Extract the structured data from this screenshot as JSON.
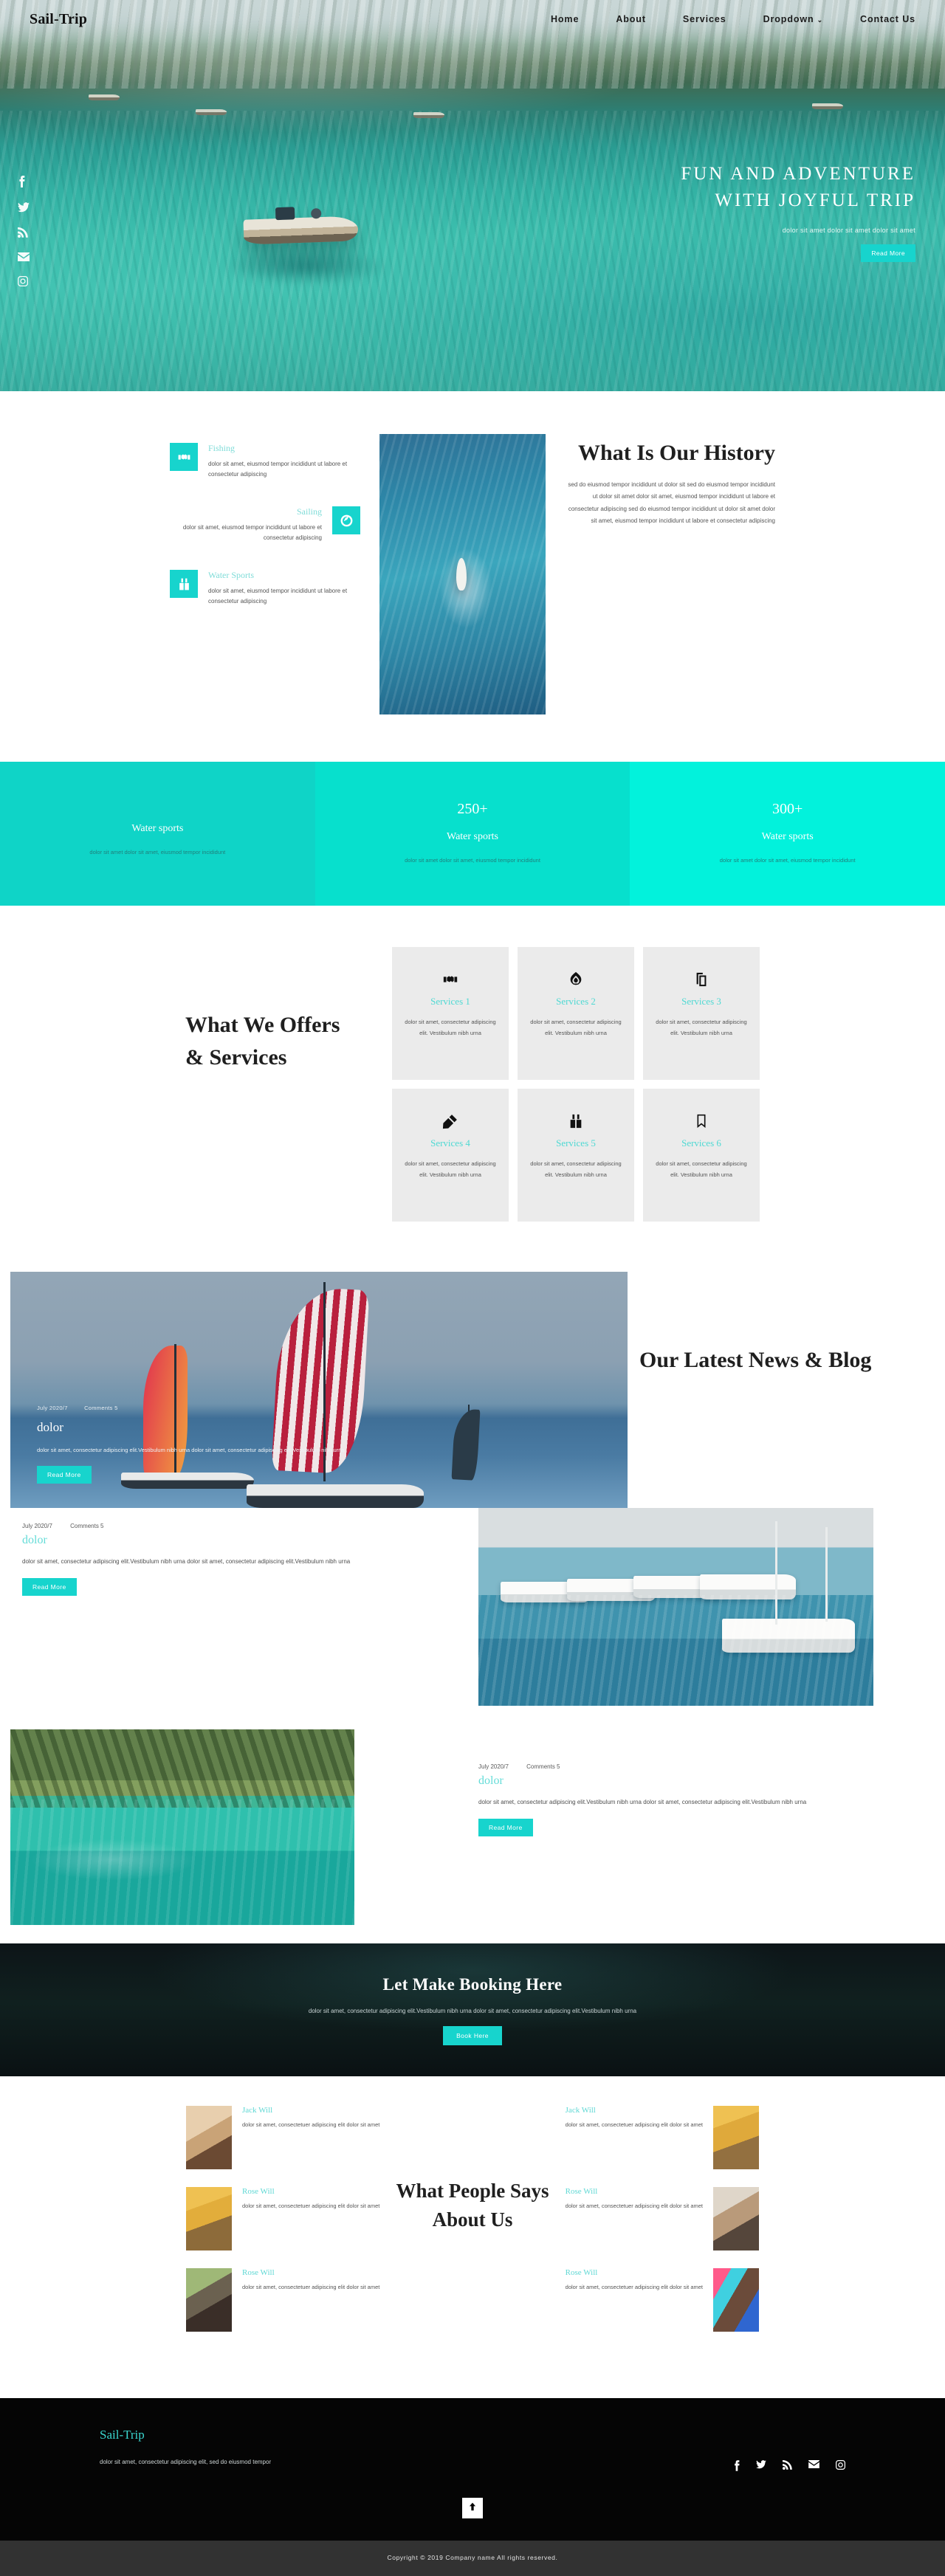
{
  "brand": "Sail-Trip",
  "nav": {
    "items": [
      {
        "label": "Home"
      },
      {
        "label": "About"
      },
      {
        "label": "Services"
      },
      {
        "label": "Dropdown",
        "caret": "⌄"
      },
      {
        "label": "Contact Us"
      }
    ]
  },
  "hero": {
    "title_line1": "FUN AND ADVENTURE",
    "title_line2": "WITH JOYFUL TRIP",
    "subtitle": "dolor sit amet dolor sit amet dolor sit amet",
    "button": "Read More",
    "social": [
      "facebook-icon",
      "twitter-icon",
      "rss-icon",
      "mail-icon",
      "instagram-icon"
    ]
  },
  "history": {
    "heading": "What Is Our History",
    "paragraph": "sed do eiusmod tempor incididunt ut dolor sit sed do eiusmod tempor incididunt ut dolor sit amet dolor sit amet, eiusmod tempor incididunt ut labore et consectetur adipiscing sed do eiusmod tempor incididunt ut dolor sit amet dolor sit amet, eiusmod tempor incididunt ut labore et consectetur adipiscing",
    "features": [
      {
        "title": "Fishing",
        "text": "dolor sit amet, eiusmod tempor incididunt ut labore et consectetur adipiscing",
        "icon": "handshake-icon"
      },
      {
        "title": "Sailing",
        "text": "dolor sit amet, eiusmod tempor incididunt ut labore et consectetur adipiscing",
        "icon": "compass-icon"
      },
      {
        "title": "Water Sports",
        "text": "dolor sit amet, eiusmod tempor incididunt ut labore et consectetur adipiscing",
        "icon": "binoculars-icon"
      }
    ]
  },
  "stats": {
    "colors": [
      "#0fd4c7",
      "#07e0cd",
      "#02f2dc"
    ],
    "items": [
      {
        "number": "",
        "title": "Water sports",
        "text": "dolor sit amet dolor sit amet, eiusmod tempor incididunt"
      },
      {
        "number": "250+",
        "title": "Water sports",
        "text": "dolor sit amet dolor sit amet, eiusmod tempor incididunt"
      },
      {
        "number": "300+",
        "title": "Water sports",
        "text": "dolor sit amet dolor sit amet, eiusmod tempor incididunt"
      }
    ]
  },
  "services": {
    "heading": "What We Offers & Services",
    "cards": [
      {
        "title": "Services 1",
        "text": "dolor sit amet, consectetur adipiscing elit. Vestibulum nibh urna",
        "icon": "handshake-icon"
      },
      {
        "title": "Services 2",
        "text": "dolor sit amet, consectetur adipiscing elit. Vestibulum nibh urna",
        "icon": "flame-icon"
      },
      {
        "title": "Services 3",
        "text": "dolor sit amet, consectetur adipiscing elit. Vestibulum nibh urna",
        "icon": "copy-icon"
      },
      {
        "title": "Services 4",
        "text": "dolor sit amet, consectetur adipiscing elit. Vestibulum nibh urna",
        "icon": "pencil-icon"
      },
      {
        "title": "Services 5",
        "text": "dolor sit amet, consectetur adipiscing elit. Vestibulum nibh urna",
        "icon": "binoculars-icon"
      },
      {
        "title": "Services 6",
        "text": "dolor sit amet, consectetur adipiscing elit. Vestibulum nibh urna",
        "icon": "bookmark-icon"
      }
    ]
  },
  "blog": {
    "heading": "Our Latest News & Blog",
    "posts": [
      {
        "date": "July 2020/7",
        "comments": "Comments 5",
        "title": "dolor",
        "excerpt": "dolor sit amet, consectetur adipiscing elit.Vestibulum nibh urna dolor sit amet, consectetur adipiscing elit.Vestibulum nibh urna",
        "button": "Read More"
      },
      {
        "date": "July 2020/7",
        "comments": "Comments 5",
        "title": "dolor",
        "excerpt": "dolor sit amet, consectetur adipiscing elit.Vestibulum nibh urna dolor sit amet, consectetur adipiscing elit.Vestibulum nibh urna",
        "button": "Read More"
      },
      {
        "date": "July 2020/7",
        "comments": "Comments 5",
        "title": "dolor",
        "excerpt": "dolor sit amet, consectetur adipiscing elit.Vestibulum nibh urna dolor sit amet, consectetur adipiscing elit.Vestibulum nibh urna",
        "button": "Read More"
      }
    ]
  },
  "booking": {
    "heading": "Let Make Booking Here",
    "text": "dolor sit amet, consectetur adipiscing elit.Vestibulum nibh urna dolor sit amet, consectetur adipiscing elit.Vestibulum nibh urna",
    "button": "Book Here"
  },
  "testimonials": {
    "heading": "What People Says About Us",
    "left": [
      {
        "name": "Jack Will",
        "text": "dolor sit amet, consectetuer adipiscing elit dolor sit amet"
      },
      {
        "name": "Rose Will",
        "text": "dolor sit amet, consectetuer adipiscing elit dolor sit amet"
      },
      {
        "name": "Rose Will",
        "text": "dolor sit amet, consectetuer adipiscing elit dolor sit amet"
      }
    ],
    "right": [
      {
        "name": "Jack Will",
        "text": "dolor sit amet, consectetuer adipiscing elit dolor sit amet"
      },
      {
        "name": "Rose Will",
        "text": "dolor sit amet, consectetuer adipiscing elit dolor sit amet"
      },
      {
        "name": "Rose Will",
        "text": "dolor sit amet, consectetuer adipiscing elit dolor sit amet"
      }
    ]
  },
  "footer": {
    "brand": "Sail-Trip",
    "tagline": "dolor sit amet, consectetur adipiscing elit, sed do eiusmod tempor",
    "social": [
      "facebook-icon",
      "twitter-icon",
      "rss-icon",
      "mail-icon",
      "instagram-icon"
    ],
    "to_top": "arrow-up-icon",
    "copyright": "Copyright © 2019 Company name All rights reserved."
  },
  "theme": {
    "accent": "#17d4cd",
    "accent_light": "#65dcd8",
    "dark": "#050505"
  }
}
